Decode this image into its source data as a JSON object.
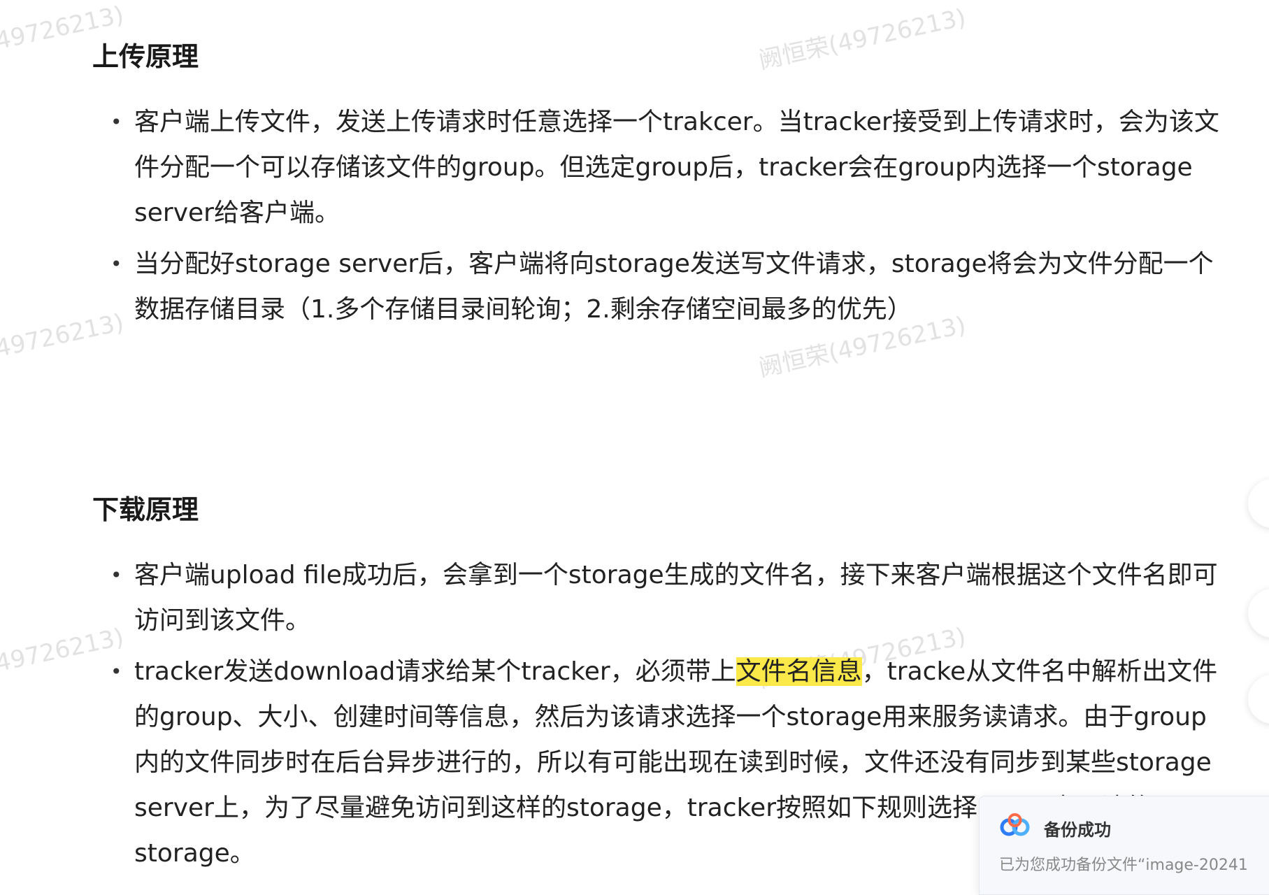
{
  "watermark": {
    "text_partial": "49726213)",
    "text_full": "阙恒荣(49726213)"
  },
  "sections": [
    {
      "heading": "上传原理",
      "items": [
        {
          "text": "客户端上传文件，发送上传请求时任意选择一个trakcer。当tracker接受到上传请求时，会为该文件分配一个可以存储该文件的group。但选定group后，tracker会在group内选择一个storage server给客户端。"
        },
        {
          "text": "当分配好storage server后，客户端将向storage发送写文件请求，storage将会为文件分配一个数据存储目录（1.多个存储目录间轮询；2.剩余存储空间最多的优先）"
        }
      ]
    },
    {
      "heading": "下载原理",
      "items": [
        {
          "text": "客户端upload file成功后，会拿到一个storage生成的文件名，接下来客户端根据这个文件名即可访问到该文件。"
        },
        {
          "text_before": "tracker发送download请求给某个tracker，必须带上",
          "highlight": "文件名信息",
          "text_after": "，tracke从文件名中解析出文件的group、大小、创建时间等信息，然后为该请求选择一个storage用来服务读请求。由于group内的文件同步时在后台异步进行的，所以有可能出现在读到时候，文件还没有同步到某些storage server上，为了尽量避免访问到这样的storage，tracker按照如下规则选择group内可读的storage。"
        }
      ]
    }
  ],
  "toast": {
    "title": "备份成功",
    "message": "已为您成功备份文件“image-20241"
  },
  "colors": {
    "highlight": "#fbe94a",
    "toast_icon_primary": "#2f7df6",
    "toast_icon_accent": "#ff6b4a"
  }
}
